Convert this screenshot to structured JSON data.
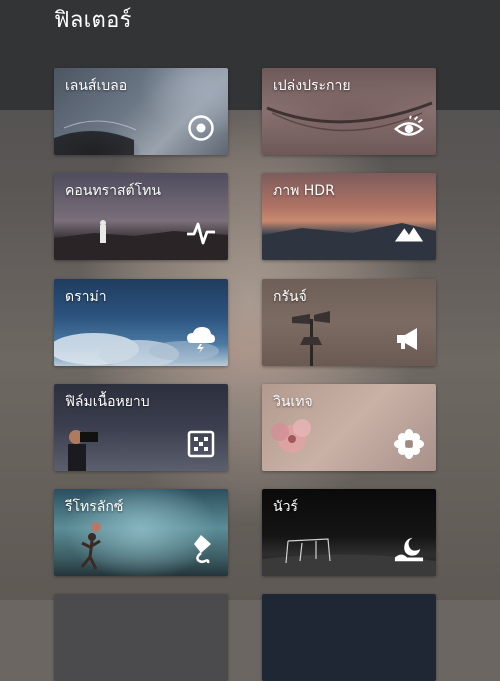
{
  "header": {
    "title": "ฟิลเตอร์"
  },
  "filters": [
    {
      "label": "เลนส์เบลอ",
      "icon": "target-icon"
    },
    {
      "label": "เปล่งประกาย",
      "icon": "eye-icon"
    },
    {
      "label": "คอนทราสต์โทน",
      "icon": "pulse-icon"
    },
    {
      "label": "ภาพ HDR",
      "icon": "mountain-icon"
    },
    {
      "label": "ดราม่า",
      "icon": "storm-cloud-icon"
    },
    {
      "label": "กรันจ์",
      "icon": "megaphone-icon"
    },
    {
      "label": "ฟิล์มเนื้อหยาบ",
      "icon": "dice-icon"
    },
    {
      "label": "วินเทจ",
      "icon": "flower-icon"
    },
    {
      "label": "รีโทรลักซ์",
      "icon": "kite-icon"
    },
    {
      "label": "นัวร์",
      "icon": "moon-landscape-icon"
    }
  ],
  "colors": {
    "header_bg": "#333435",
    "text": "#ffffff"
  }
}
